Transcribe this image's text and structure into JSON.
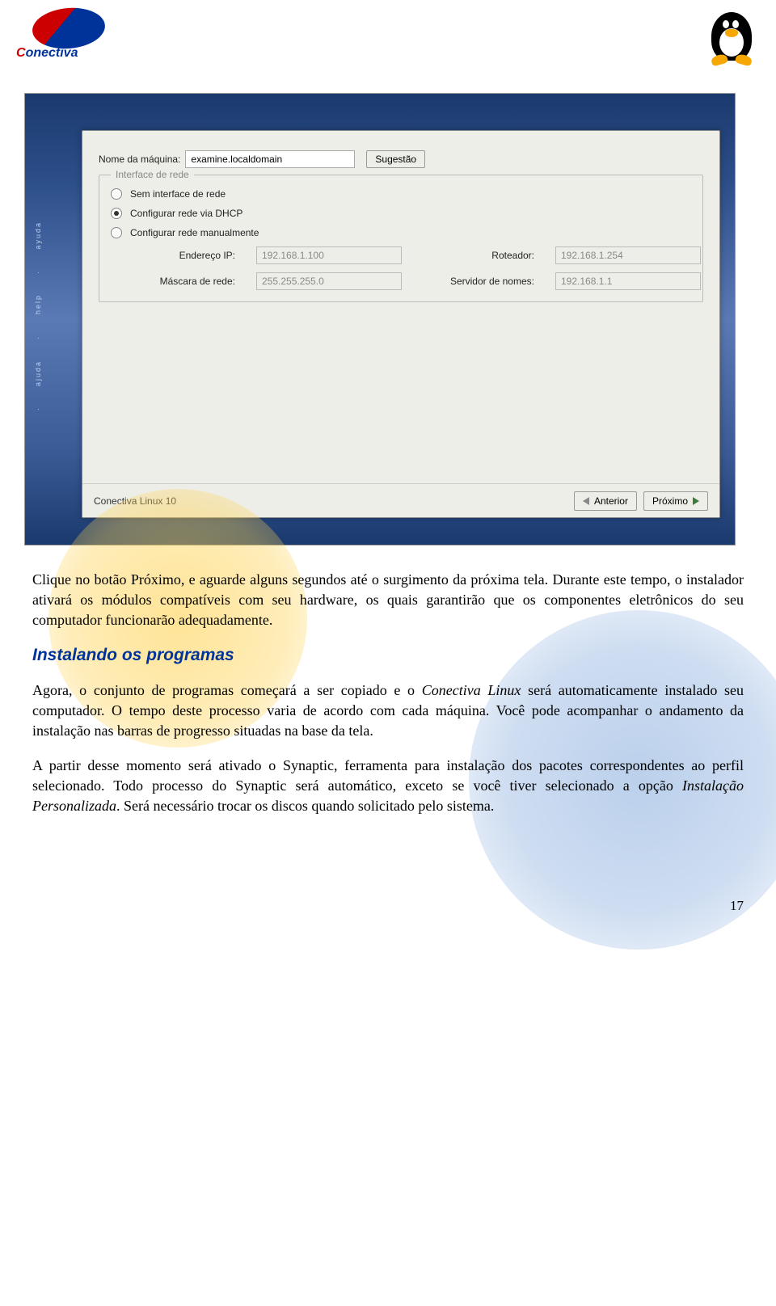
{
  "header": {
    "brand": "Conectiva"
  },
  "sidebar": {
    "tab1": "ajuda",
    "tab2": "help",
    "tab3": "ayuda"
  },
  "dialog": {
    "hostname_label": "Nome da máquina:",
    "hostname_value": "examine.localdomain",
    "suggest_button": "Sugestão",
    "fieldset_title": "Interface de rede",
    "radio_none": "Sem interface de rede",
    "radio_dhcp": "Configurar rede via DHCP",
    "radio_manual": "Configurar rede manualmente",
    "ip_label": "Endereço IP:",
    "ip_value": "192.168.1.100",
    "router_label": "Roteador:",
    "router_value": "192.168.1.254",
    "netmask_label": "Máscara de rede:",
    "netmask_value": "255.255.255.0",
    "nameserver_label": "Servidor de nomes:",
    "nameserver_value": "192.168.1.1",
    "footer_title": "Conectiva Linux 10",
    "prev_button": "Anterior",
    "next_button": "Próximo"
  },
  "doc": {
    "p1": "Clique no botão Próximo, e aguarde alguns segundos até o surgimento da próxima tela. Durante este tempo, o instalador ativará os módulos compatíveis com seu hardware, os quais garantirão que os componentes eletrônicos do seu computador funcionarão adequadamente.",
    "h3": "Instalando os programas",
    "p2a": "Agora, o conjunto de programas começará a ser copiado e o ",
    "p2em": "Conectiva Linux",
    "p2b": " será automaticamente instalado seu computador. O tempo deste processo varia de acordo com cada máquina. Você pode acompanhar o andamento da instalação nas barras de progresso situadas na base da tela.",
    "p3a": "A partir desse momento será ativado o Synaptic, ferramenta para instalação dos pacotes correspondentes ao perfil selecionado. Todo processo do Synaptic será automático, exceto se você tiver selecionado a opção ",
    "p3em": "Instalação Personalizada",
    "p3b": ". Será necessário trocar os discos quando solicitado pelo sistema.",
    "page_number": "17"
  }
}
